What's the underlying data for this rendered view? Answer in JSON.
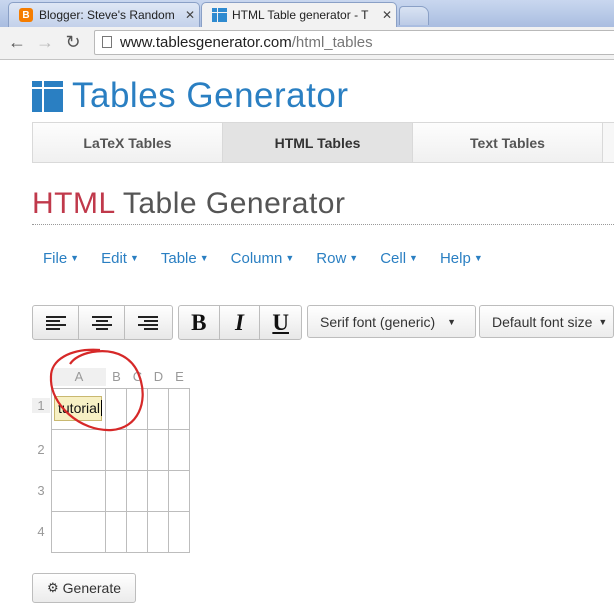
{
  "browser": {
    "tabs": [
      {
        "title": "Blogger: Steve's Random",
        "favicon": "blogger-icon"
      },
      {
        "title": "HTML Table generator - T",
        "favicon": "tables-generator-icon"
      }
    ],
    "url_host": "www.tablesgenerator.com",
    "url_path": "/html_tables"
  },
  "site": {
    "logo_text": "Tables Generator",
    "nav_tabs": [
      "LaTeX Tables",
      "HTML Tables",
      "Text Tables"
    ],
    "active_tab": "HTML Tables"
  },
  "page": {
    "heading_highlight": "HTML",
    "heading_rest": " Table Generator"
  },
  "menu": [
    "File",
    "Edit",
    "Table",
    "Column",
    "Row",
    "Cell",
    "Help"
  ],
  "format_toolbar": {
    "bold": "B",
    "italic": "I",
    "underline": "U",
    "font_family": "Serif font (generic)",
    "font_size": "Default font size"
  },
  "grid": {
    "columns": [
      "A",
      "B",
      "C",
      "D",
      "E"
    ],
    "rows": [
      "1",
      "2",
      "3",
      "4"
    ],
    "editing_cell_value": "tutorial"
  },
  "generate_label": "Generate",
  "colors": {
    "accent": "#2a7fc2",
    "heading_red": "#c0394b",
    "annotation": "#d62828"
  }
}
